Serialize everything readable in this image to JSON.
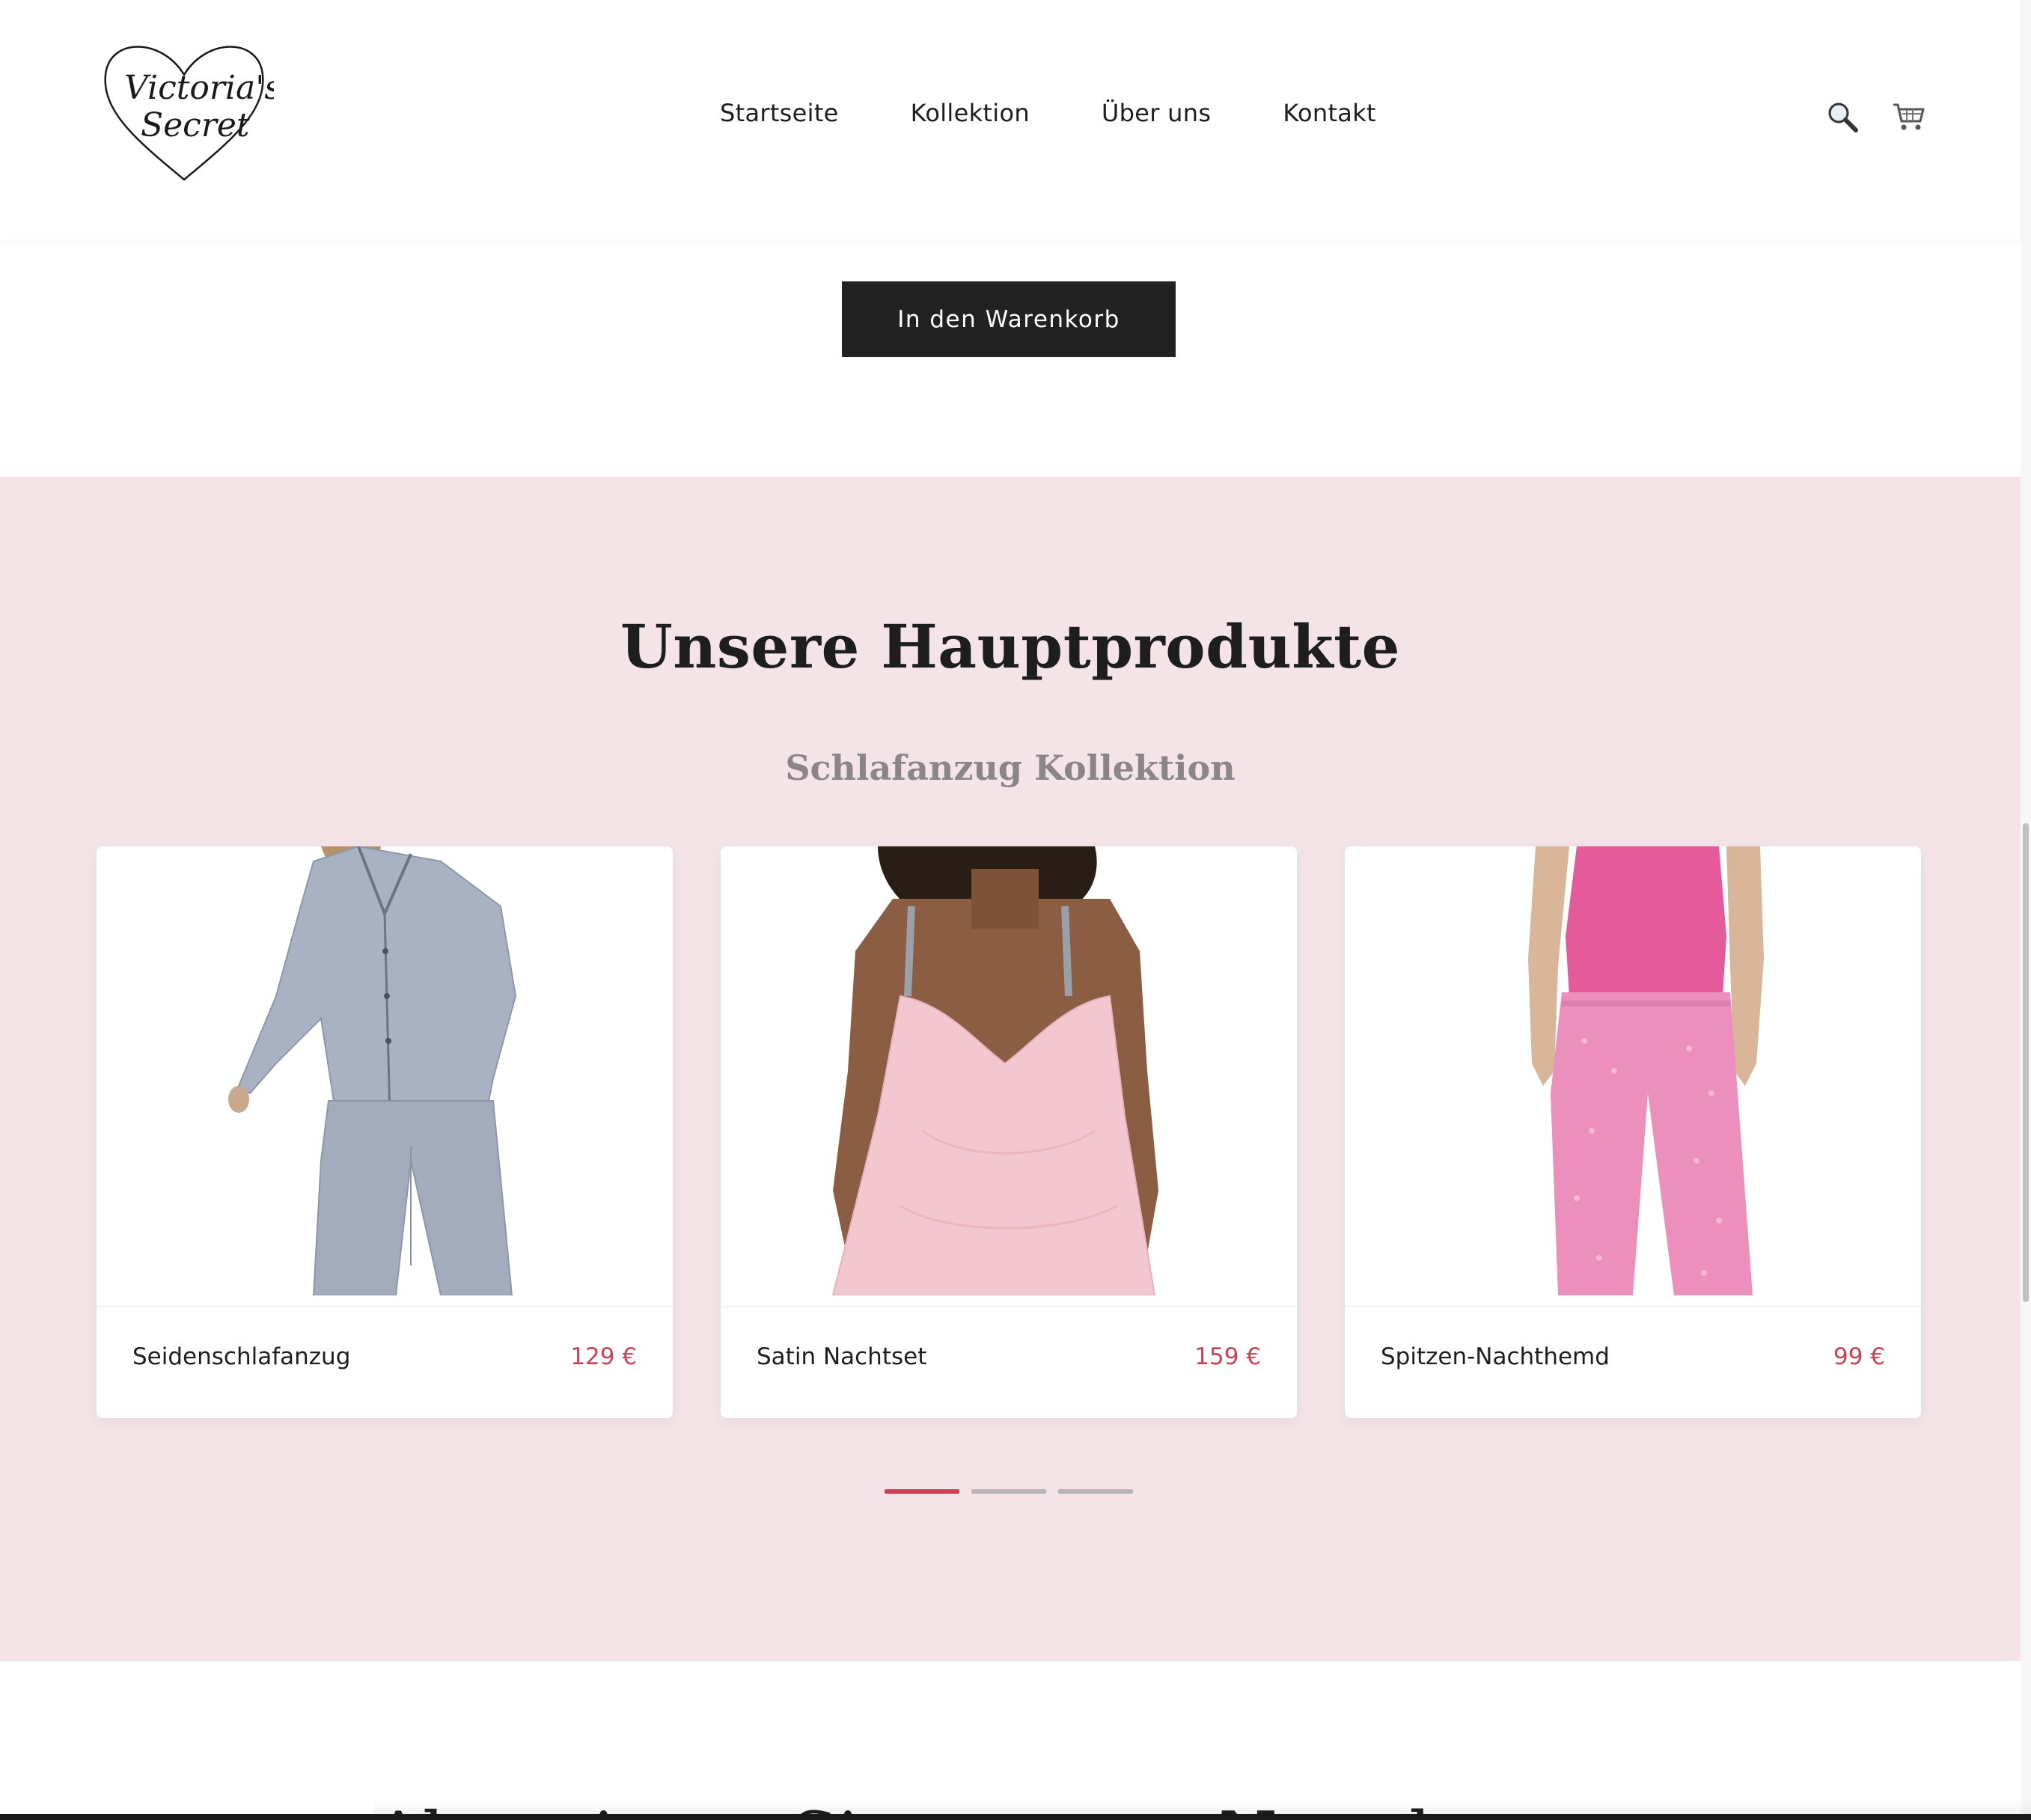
{
  "header": {
    "logo_text_line1": "Victoria's",
    "logo_text_line2": "Secret",
    "nav": [
      {
        "label": "Startseite"
      },
      {
        "label": "Kollektion"
      },
      {
        "label": "Über uns"
      },
      {
        "label": "Kontakt"
      }
    ],
    "icons": [
      "search-icon",
      "cart-icon"
    ]
  },
  "cart_button": {
    "label": "In den Warenkorb"
  },
  "products": {
    "title": "Unsere Hauptprodukte",
    "subtitle": "Schlafanzug Kollektion",
    "items": [
      {
        "name": "Seidenschlafanzug",
        "price": "129 €",
        "image": "grey-silk-pajama"
      },
      {
        "name": "Satin Nachtset",
        "price": "159 €",
        "image": "pink-satin-slip"
      },
      {
        "name": "Spitzen-Nachthemd",
        "price": "99 €",
        "image": "pink-top-pants"
      }
    ],
    "carousel": {
      "pages": 3,
      "active": 1
    }
  },
  "newsletter": {
    "title_partial": "Abonnieren Sie unseren Newsletter"
  },
  "colors": {
    "accent": "#c94356",
    "section_bg": "#f4e3e7",
    "button_bg": "#222222"
  }
}
